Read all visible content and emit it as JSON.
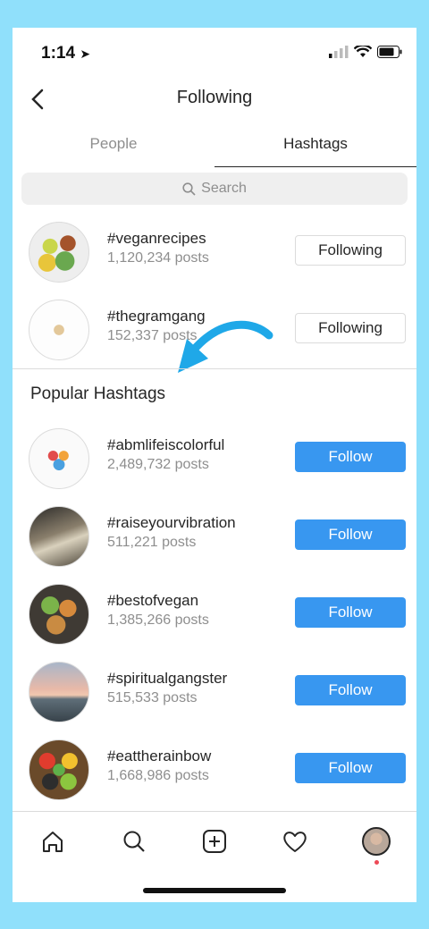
{
  "status": {
    "time": "1:14"
  },
  "nav": {
    "title": "Following"
  },
  "tabs": [
    {
      "label": "People",
      "active": false
    },
    {
      "label": "Hashtags",
      "active": true
    }
  ],
  "search": {
    "placeholder": "Search"
  },
  "following": [
    {
      "tag": "#veganrecipes",
      "posts": "1,120,234 posts",
      "button": "Following"
    },
    {
      "tag": "#thegramgang",
      "posts": "152,337 posts",
      "button": "Following"
    }
  ],
  "popular": {
    "title": "Popular Hashtags",
    "items": [
      {
        "tag": "#abmlifeiscolorful",
        "posts": "2,489,732 posts",
        "button": "Follow"
      },
      {
        "tag": "#raiseyourvibration",
        "posts": "511,221 posts",
        "button": "Follow"
      },
      {
        "tag": "#bestofvegan",
        "posts": "1,385,266 posts",
        "button": "Follow"
      },
      {
        "tag": "#spiritualgangster",
        "posts": "515,533 posts",
        "button": "Follow"
      },
      {
        "tag": "#eattherainbow",
        "posts": "1,668,986 posts",
        "button": "Follow"
      }
    ]
  },
  "colors": {
    "accent": "#3897f0",
    "background": "#90e0fb",
    "annotation_arrow": "#1fa8e8"
  },
  "tabbar": [
    "home-icon",
    "search-icon",
    "add-icon",
    "heart-icon",
    "profile-avatar"
  ]
}
